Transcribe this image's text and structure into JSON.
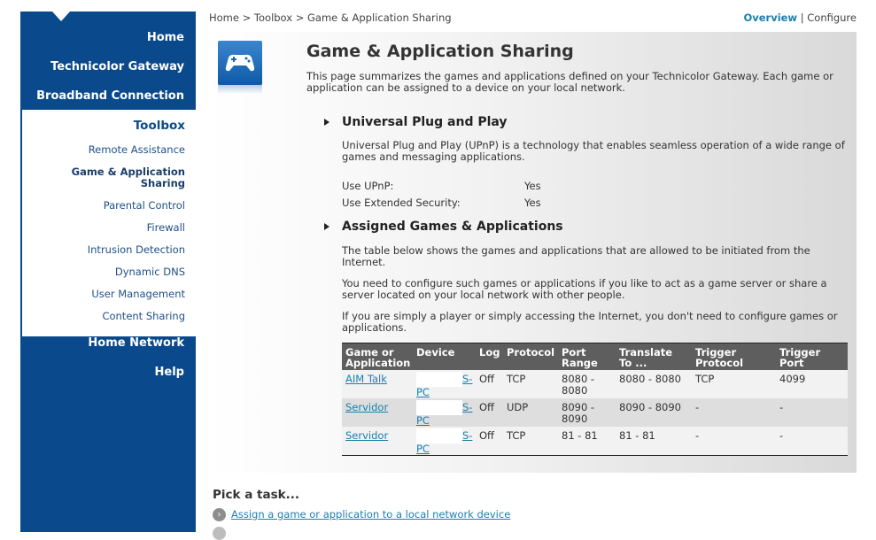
{
  "sidebar": {
    "home": "Home",
    "gateway": "Technicolor Gateway",
    "broadband": "Broadband Connection",
    "toolbox": "Toolbox",
    "toolbox_items": [
      {
        "label": "Remote Assistance"
      },
      {
        "label": "Game & Application\nSharing"
      },
      {
        "label": "Parental Control"
      },
      {
        "label": "Firewall"
      },
      {
        "label": "Intrusion Detection"
      },
      {
        "label": "Dynamic DNS"
      },
      {
        "label": "User Management"
      },
      {
        "label": "Content Sharing"
      }
    ],
    "home_network": "Home Network",
    "help": "Help"
  },
  "breadcrumb": {
    "home": "Home",
    "sep": ">",
    "toolbox": "Toolbox",
    "current": "Game & Application Sharing"
  },
  "view_links": {
    "overview": "Overview",
    "divider": "|",
    "configure": "Configure"
  },
  "page": {
    "title": "Game & Application Sharing",
    "intro": "This page summarizes the games and applications defined on your Technicolor Gateway. Each game or application can be assigned to a device on your local network.",
    "upnp": {
      "title": "Universal Plug and Play",
      "desc": "Universal Plug and Play (UPnP) is a technology that enables seamless operation of a wide range of games and messaging applications.",
      "use_upnp_label": "Use UPnP:",
      "use_upnp_value": "Yes",
      "ext_sec_label": "Use Extended Security:",
      "ext_sec_value": "Yes"
    },
    "assigned": {
      "title": "Assigned Games & Applications",
      "p1": "The table below shows the games and applications that are allowed to be initiated from the Internet.",
      "p2": "You need to configure such games or applications if you like to act as a game server or share a server located on your local network with other people.",
      "p3": "If you are simply a player or simply accessing the Internet, you don't need to configure games or applications."
    }
  },
  "table": {
    "headers": {
      "game": "Game or Application",
      "device": "Device",
      "log": "Log",
      "protocol": "Protocol",
      "port_range": "Port Range",
      "translate": "Translate To ...",
      "trigger_protocol": "Trigger Protocol",
      "trigger_port": "Trigger Port"
    },
    "rows": [
      {
        "game": "AIM Talk",
        "device_a": "S-",
        "device_b": "PC",
        "log": "Off",
        "protocol": "TCP",
        "port_range": "8080 - 8080",
        "translate": "8080 - 8080",
        "trigger_protocol": "TCP",
        "trigger_port": "4099"
      },
      {
        "game": "Servidor",
        "device_a": "S-",
        "device_b": "PC",
        "log": "Off",
        "protocol": "UDP",
        "port_range": "8090 - 8090",
        "translate": "8090 - 8090",
        "trigger_protocol": "-",
        "trigger_port": "-"
      },
      {
        "game": "Servidor",
        "device_a": "S-",
        "device_b": "PC",
        "log": "Off",
        "protocol": "TCP",
        "port_range": "81 - 81",
        "translate": "81 - 81",
        "trigger_protocol": "-",
        "trigger_port": "-"
      }
    ]
  },
  "tasks": {
    "title": "Pick a task...",
    "items": [
      {
        "label": "Assign a game or application to a local network device"
      }
    ]
  },
  "colors": {
    "brand_blue": "#0a4a8c",
    "link": "#1a7fb0",
    "table_header": "#5e5e5e"
  }
}
